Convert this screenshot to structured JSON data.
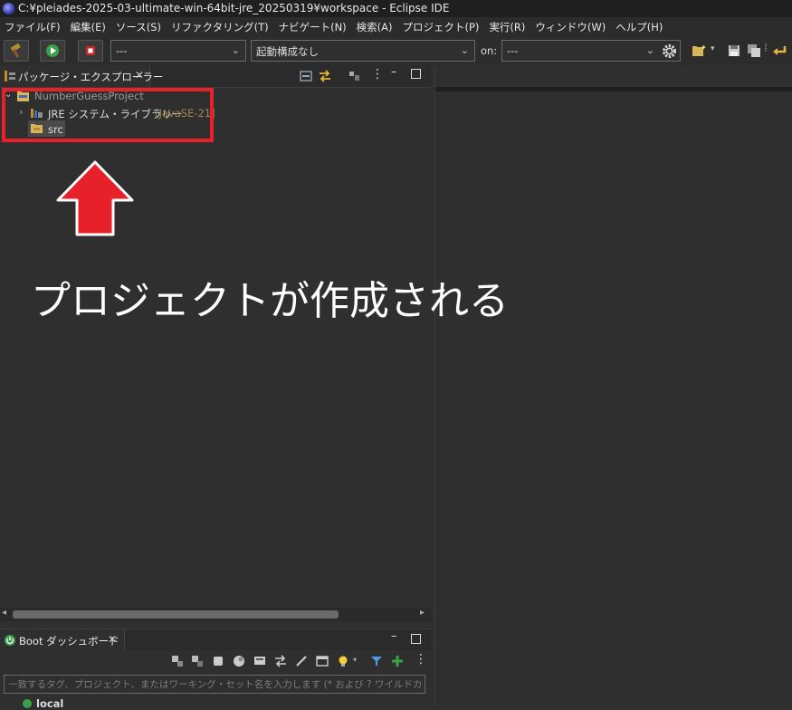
{
  "window": {
    "title": "C:¥pleiades-2025-03-ultimate-win-64bit-jre_20250319¥workspace - Eclipse IDE"
  },
  "menu": [
    "ファイル(F)",
    "編集(E)",
    "ソース(S)",
    "リファクタリング(T)",
    "ナビゲート(N)",
    "検索(A)",
    "プロジェクト(P)",
    "実行(R)",
    "ウィンドウ(W)",
    "ヘルプ(H)"
  ],
  "toolbar": {
    "mode_combo_value": "---",
    "launch_config_value": "起動構成なし",
    "on_label": "on:",
    "target_combo_value": "---"
  },
  "package_explorer": {
    "tab_label": "パッケージ・エクスプローラー",
    "tree": {
      "project_name": "NumberGuessProject",
      "jre_label": "JRE システム・ライブラリー",
      "jre_version": "[JavaSE-21]",
      "src_label": "src"
    }
  },
  "boot_dashboard": {
    "tab_label": "Boot ダッシュボード",
    "filter_placeholder": "一致するタグ、プロジェクト、またはワーキング・セット名を入力します (* および ? ワイルドカードを含む)",
    "first_item_label": "local"
  },
  "annotation": {
    "caption": "プロジェクトが作成される",
    "highlight_color": "#e8202a",
    "arrow_color": "#e8202a"
  },
  "colors": {
    "background": "#2f2f2f",
    "accent_green": "#3aa14a",
    "accent_red": "#c92727"
  }
}
